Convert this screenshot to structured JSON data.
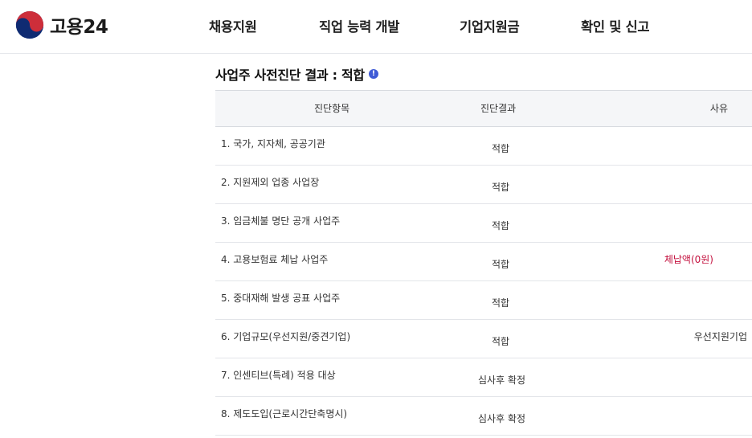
{
  "brand": {
    "name": "고용24",
    "logo_icon": "taegeuk-emblem-icon"
  },
  "nav": [
    {
      "label": "채용지원"
    },
    {
      "label": "직업 능력 개발"
    },
    {
      "label": "기업지원금"
    },
    {
      "label": "확인 및 신고"
    }
  ],
  "section": {
    "title": "사업주 사전진단 결과 : 적합",
    "info_icon": "!"
  },
  "table": {
    "headers": {
      "item": "진단항목",
      "result": "진단결과",
      "reason": "사유"
    },
    "rows": [
      {
        "item": "1. 국가, 지자체, 공공기관",
        "result": "적합",
        "reason": ""
      },
      {
        "item": "2. 지원제외 업종 사업장",
        "result": "적합",
        "reason": ""
      },
      {
        "item": "3. 임금체불 명단 공개 사업주",
        "result": "적합",
        "reason": ""
      },
      {
        "item": "4. 고용보험료 체납 사업주",
        "result": "적합",
        "reason": "체납액(0원)"
      },
      {
        "item": "5. 중대재해 발생 공표 사업주",
        "result": "적합",
        "reason": ""
      },
      {
        "item": "6. 기업규모(우선지원/중견기업)",
        "result": "적합",
        "reason": "우선지원기업"
      },
      {
        "item": "7. 인센티브(특례) 적용 대상",
        "result": "심사후 확정",
        "reason": ""
      },
      {
        "item": "8. 제도도입(근로시간단축명시)",
        "result": "심사후 확정",
        "reason": ""
      }
    ]
  },
  "colors": {
    "alert": "#c4123f",
    "accent": "#3f5bd6",
    "header_bg": "#f5f6f8"
  }
}
